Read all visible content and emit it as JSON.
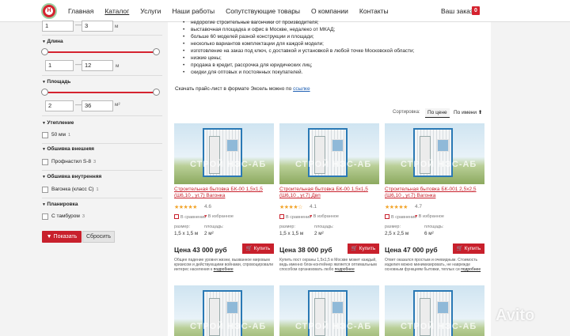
{
  "header": {
    "logo_letter": "Н",
    "nav": [
      "Главная",
      "Каталог",
      "Услуги",
      "Наши работы",
      "Сопутствующие товары",
      "О компании",
      "Контакты"
    ],
    "order_label": "Ваш заказ",
    "order_count": "0"
  },
  "sidebar": {
    "width_from": "1",
    "width_to": "3",
    "width_unit": "м",
    "length_head": "Длина",
    "length_from": "1",
    "length_to": "12",
    "length_unit": "м",
    "area_head": "Площадь",
    "area_from": "2",
    "area_to": "36",
    "area_unit": "м²",
    "insulation_head": "Утепление",
    "insulation_opt": "50 мм",
    "insulation_count": "1",
    "outer_head": "Обшивка внешняя",
    "outer_opt": "Профнастил S-8",
    "outer_count": "3",
    "inner_head": "Обшивка внутренняя",
    "inner_opt": "Вагонка (класс С)",
    "inner_count": "1",
    "layout_head": "Планировка",
    "layout_opt": "С тамбуром",
    "layout_count": "3",
    "show_btn": "Показать",
    "reset_btn": "Сбросить"
  },
  "main": {
    "bullets": [
      "недорогие строительные вагончики от производителя;",
      "выставочная площадка и офис в Москве, недалеко от МКАД;",
      "больше 60 моделей разной конструкции и площади;",
      "несколько вариантов комплектации для каждой модели;",
      "изготовление на заказ под ключ, с доставкой и установкой в любой точке Московской области;",
      "низкие цены;",
      "продажа в кредит, рассрочка для юридических лиц;",
      "скидки для оптовых и постоянных покупателей."
    ],
    "pricelist_text": "Скачать прайс-лист в формате Эксель можно по",
    "pricelist_link": "ссылке",
    "sort_label": "Сортировка:",
    "sort_price": "По цене",
    "sort_name": "По имени ⬆"
  },
  "cards": [
    {
      "title": "Строительная бытовка БК-00 1,5х1,5 (Ш6,10 , уг.7) Вагонка",
      "stars": "★★★★★",
      "rating": "4.6",
      "compare": "В сравнение",
      "favorite": "В избранное",
      "size_label": "размер:",
      "size": "1,5 x 1,5 м",
      "area_label": "площадь:",
      "area": "2 м²",
      "price": "Цена 43 000 руб",
      "buy": "Купить",
      "desc": "Общее падение уровня жизни, вызванное мировым кризисом  и действующими войнами, спровоцировали интерес населения  к",
      "more": "подробнее"
    },
    {
      "title": "Строительная бытовка БК-00 1,5х1,5 (Ш6,10 , уг.7) Двп",
      "stars": "★★★★☆",
      "rating": "4.1",
      "compare": "В сравнение",
      "favorite": "В избранное",
      "size_label": "размер:",
      "size": "1,5 x 1,5 м",
      "area_label": "площадь:",
      "area": "2 м²",
      "price": "Цена 38 000 руб",
      "buy": "Купить",
      "desc": "Купить пост охраны 1,5х1,5 в Москве может каждый, ведь именно блок-контейнер является оптимальным способом организовать любо",
      "more": "подробнее"
    },
    {
      "title": "Строительная бытовка БК-001 2,5х2,5 (Ш6,10 , уг.7) Вагонка",
      "stars": "★★★★★",
      "rating": "4.7",
      "compare": "В сравнение",
      "favorite": "В избранное",
      "size_label": "размер:",
      "size": "2,5 x 2,5 м",
      "area_label": "площадь:",
      "area": "6 м²",
      "price": "Цена 47 000 руб",
      "buy": "Купить",
      "desc": "Ответ оказался простым и очевидным. Стоимость изделия можно минимизировать, не наврежде основным функциям бытовки,  теплых си",
      "more": "подробнее"
    }
  ],
  "watermark": "СТРОЙ НЭС-АБ",
  "avito": "Avito"
}
